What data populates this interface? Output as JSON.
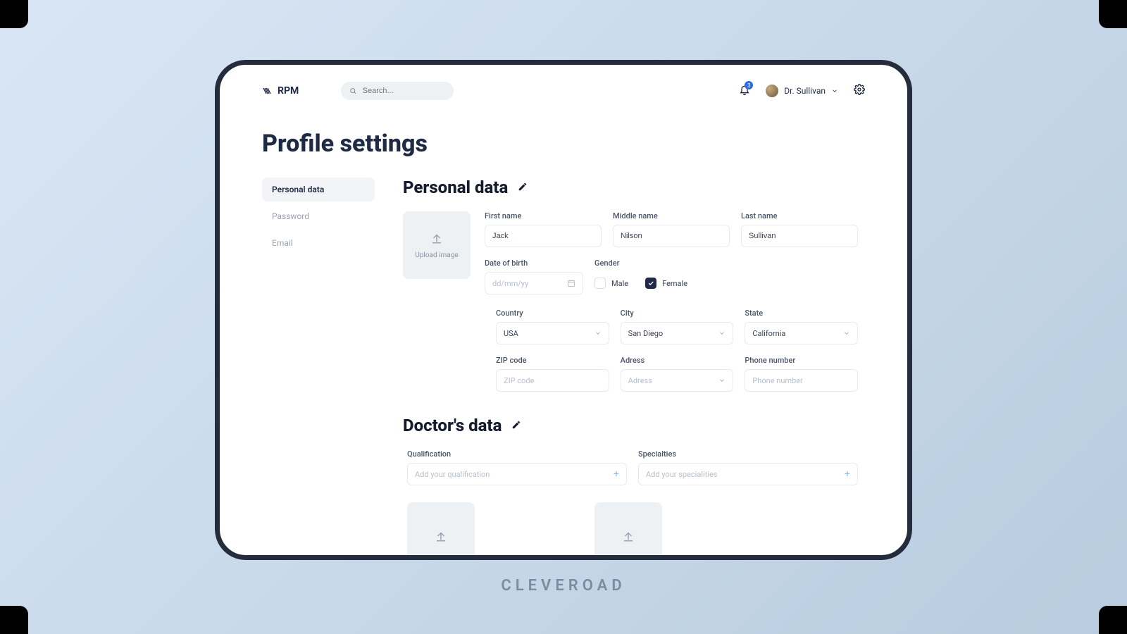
{
  "brand": "RPM",
  "search_placeholder": "Search...",
  "notifications_count": "3",
  "user_name": "Dr. Sullivan",
  "page_title": "Profile settings",
  "tabs": {
    "personal": "Personal data",
    "password": "Password",
    "email": "Email"
  },
  "section": {
    "personal": "Personal data",
    "doctor": "Doctor's data"
  },
  "upload_label": "Upload image",
  "labels": {
    "first_name": "First name",
    "middle_name": "Middle name",
    "last_name": "Last name",
    "dob": "Date of birth",
    "gender": "Gender",
    "country": "Country",
    "city": "City",
    "state": "State",
    "zip": "ZIP code",
    "address": "Adress",
    "phone": "Phone number",
    "qualification": "Qualification",
    "specialties": "Specialties"
  },
  "values": {
    "first_name": "Jack",
    "middle_name": "Nilson",
    "last_name": "Sullivan",
    "country": "USA",
    "city": "San Diego",
    "state": "California"
  },
  "placeholders": {
    "dob": "dd/mm/yy",
    "zip": "ZIP code",
    "address": "Adress",
    "phone": "Phone number",
    "qualification": "Add your qualification",
    "specialties": "Add your specialities"
  },
  "gender": {
    "male": "Male",
    "female": "Female"
  },
  "watermark": "CLEVEROAD"
}
